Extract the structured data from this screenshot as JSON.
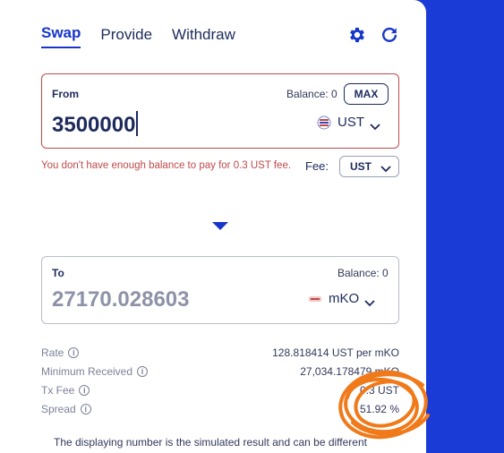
{
  "tabs": [
    {
      "label": "Swap",
      "active": true
    },
    {
      "label": "Provide",
      "active": false
    },
    {
      "label": "Withdraw",
      "active": false
    }
  ],
  "icons": {
    "settings": "gear-icon",
    "refresh": "refresh-icon"
  },
  "from": {
    "label": "From",
    "balance": "Balance: 0",
    "max_label": "MAX",
    "amount": "3500000",
    "token": "UST"
  },
  "error_message": "You don't have enough balance to pay for 0.3 UST fee.",
  "fee": {
    "label": "Fee:",
    "selected": "UST"
  },
  "to": {
    "label": "To",
    "balance": "Balance: 0",
    "amount": "27170.028603",
    "token": "mKO"
  },
  "info": [
    {
      "label": "Rate",
      "value": "128.818414 UST per mKO"
    },
    {
      "label": "Minimum Received",
      "value": "27,034.178479 mKO"
    },
    {
      "label": "Tx Fee",
      "value": "0.3 UST"
    },
    {
      "label": "Spread",
      "value": "51.92 %"
    }
  ],
  "footer_note": "The displaying number is the simulated result and can be different",
  "colors": {
    "background": "#1a3bd6",
    "accent": "#1736c9",
    "error": "#c14a4a",
    "highlight": "#f07a1a"
  }
}
